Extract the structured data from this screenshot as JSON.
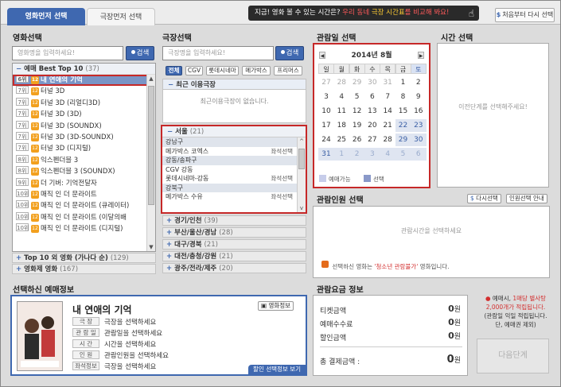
{
  "tabs": {
    "movie_first": "영화먼저 선택",
    "theater_first": "극장먼저 선택"
  },
  "promo": {
    "text1": "지금! 영화 볼 수 있는 시간은?",
    "text2": "우리 동네",
    "text3": "극장 시간표",
    "text4": "를 비교해 봐요!"
  },
  "restart_label": "처음부터 다시 선택",
  "movie": {
    "title": "영화선택",
    "search_placeholder": "영화명을 입력하세요!",
    "search_btn": "검색",
    "top10_header": "예매 Best Top 10",
    "top10_count": "(37)",
    "items": [
      {
        "rank": "6위",
        "age": "12",
        "title": "내 연애의 기억",
        "selected": true
      },
      {
        "rank": "7위",
        "age": "12",
        "title": "터널 3D"
      },
      {
        "rank": "7위",
        "age": "12",
        "title": "터널 3D (리얼디3D)"
      },
      {
        "rank": "7위",
        "age": "12",
        "title": "터널 3D (3D)"
      },
      {
        "rank": "7위",
        "age": "12",
        "title": "터널 3D (SOUNDX)"
      },
      {
        "rank": "7위",
        "age": "12",
        "title": "터널 3D (3D-SOUNDX)"
      },
      {
        "rank": "7위",
        "age": "12",
        "title": "터널 3D (디지털)"
      },
      {
        "rank": "8위",
        "age": "12",
        "title": "익스펜더블 3"
      },
      {
        "rank": "8위",
        "age": "12",
        "title": "익스펜더블 3 (SOUNDX)"
      },
      {
        "rank": "9위",
        "age": "12",
        "title": "더 기버: 기억전달자"
      },
      {
        "rank": "10위",
        "age": "12",
        "title": "매직 인 더 문라이트"
      },
      {
        "rank": "10위",
        "age": "12",
        "title": "매직 인 더 문라이트 (큐레이터)"
      },
      {
        "rank": "10위",
        "age": "12",
        "title": "매직 인 더 문라이트 (이달의배"
      },
      {
        "rank": "10위",
        "age": "12",
        "title": "매직 인 더 문라이트 (디지털)"
      }
    ],
    "alpha_header": "Top 10 외 영화 (가나다 순)",
    "alpha_count": "(129)",
    "all_header": "영화제 영화",
    "all_count": "(167)"
  },
  "theater": {
    "title": "극장선택",
    "search_placeholder": "극장명을 입력하세요!",
    "search_btn": "검색",
    "chips": [
      "전체",
      "CGV",
      "롯데시네마",
      "메가박스",
      "프리머스"
    ],
    "recent_header": "최근 이용극장",
    "recent_empty": "최근이용극장이 없습니다.",
    "seoul_header": "서울",
    "seoul_count": "(21)",
    "seoul_rows": [
      {
        "type": "region",
        "name": "강남구"
      },
      {
        "type": "theater",
        "name": "메가박스 코엑스",
        "seat": "좌석선택"
      },
      {
        "type": "region",
        "name": "강동/송파구"
      },
      {
        "type": "theater",
        "name": "CGV 강동",
        "seat": ""
      },
      {
        "type": "theater",
        "name": "롯데시네마-강동",
        "seat": "좌석선택"
      },
      {
        "type": "region",
        "name": "강북구"
      },
      {
        "type": "theater",
        "name": "메가박스 수유",
        "seat": "좌석선택"
      }
    ],
    "regions": [
      {
        "name": "경기/인천",
        "count": "(39)"
      },
      {
        "name": "부산/울산/경남",
        "count": "(28)"
      },
      {
        "name": "대구/경북",
        "count": "(21)"
      },
      {
        "name": "대전/충청/강원",
        "count": "(21)"
      },
      {
        "name": "광주/전라/제주",
        "count": "(20)"
      }
    ]
  },
  "date": {
    "title": "관람일 선택",
    "month_label": "2014년 8월",
    "dow": [
      "일",
      "월",
      "화",
      "수",
      "목",
      "금",
      "토"
    ],
    "weeks": [
      [
        "27",
        "28",
        "29",
        "30",
        "31",
        "1",
        "2"
      ],
      [
        "3",
        "4",
        "5",
        "6",
        "7",
        "8",
        "9"
      ],
      [
        "10",
        "11",
        "12",
        "13",
        "14",
        "15",
        "16"
      ],
      [
        "17",
        "18",
        "19",
        "20",
        "21",
        "22",
        "23"
      ],
      [
        "24",
        "25",
        "26",
        "27",
        "28",
        "29",
        "30"
      ],
      [
        "31",
        "1",
        "2",
        "3",
        "4",
        "5",
        "6"
      ]
    ],
    "legend_available": "예매가능",
    "legend_selected": "선택",
    "colors": {
      "available": "#c7cdea",
      "selected": "#8a99c9"
    }
  },
  "time": {
    "title": "시간 선택",
    "placeholder": "이전단계를 선택해주세요!"
  },
  "people": {
    "title": "관람인원 선택",
    "reselect": "다시선택",
    "guide": "인원선택 안내",
    "placeholder": "관람시간을 선택하세요",
    "notice_prefix": "선택하신 영화는",
    "notice_rating": "'청소년 관람불가'",
    "notice_suffix": "영화입니다."
  },
  "selected": {
    "title": "선택하신 예매정보",
    "movie_title": "내 연애의 기억",
    "movie_info_btn": "영화정보",
    "rows": [
      {
        "label": "극 장",
        "value": "극장을 선택하세요"
      },
      {
        "label": "관 람 일",
        "value": "관람일을 선택하세요"
      },
      {
        "label": "시 간",
        "value": "시간을 선택하세요"
      },
      {
        "label": "인 원",
        "value": "관람인원을 선택하세요"
      },
      {
        "label": "좌석정보",
        "value": "극장을 선택하세요"
      }
    ],
    "discount_btn": "할인 선택정보 보기"
  },
  "price": {
    "title": "관람요금 정보",
    "ticket_label": "티켓금액",
    "ticket_value": "0",
    "fee_label": "예매수수료",
    "fee_value": "0",
    "discount_label": "할인금액",
    "discount_value": "0",
    "total_label": "총 결제금액 :",
    "total_value": "0",
    "unit": "원"
  },
  "notice": {
    "line1a": "예매시,",
    "line1b": "1매당 별사탕",
    "line2": "2,000개가 적립됩니다.",
    "line3": "(관람일 익일 적립됩니다.",
    "line4": "단, 예매권 제외)"
  },
  "next_label": "다음단계"
}
